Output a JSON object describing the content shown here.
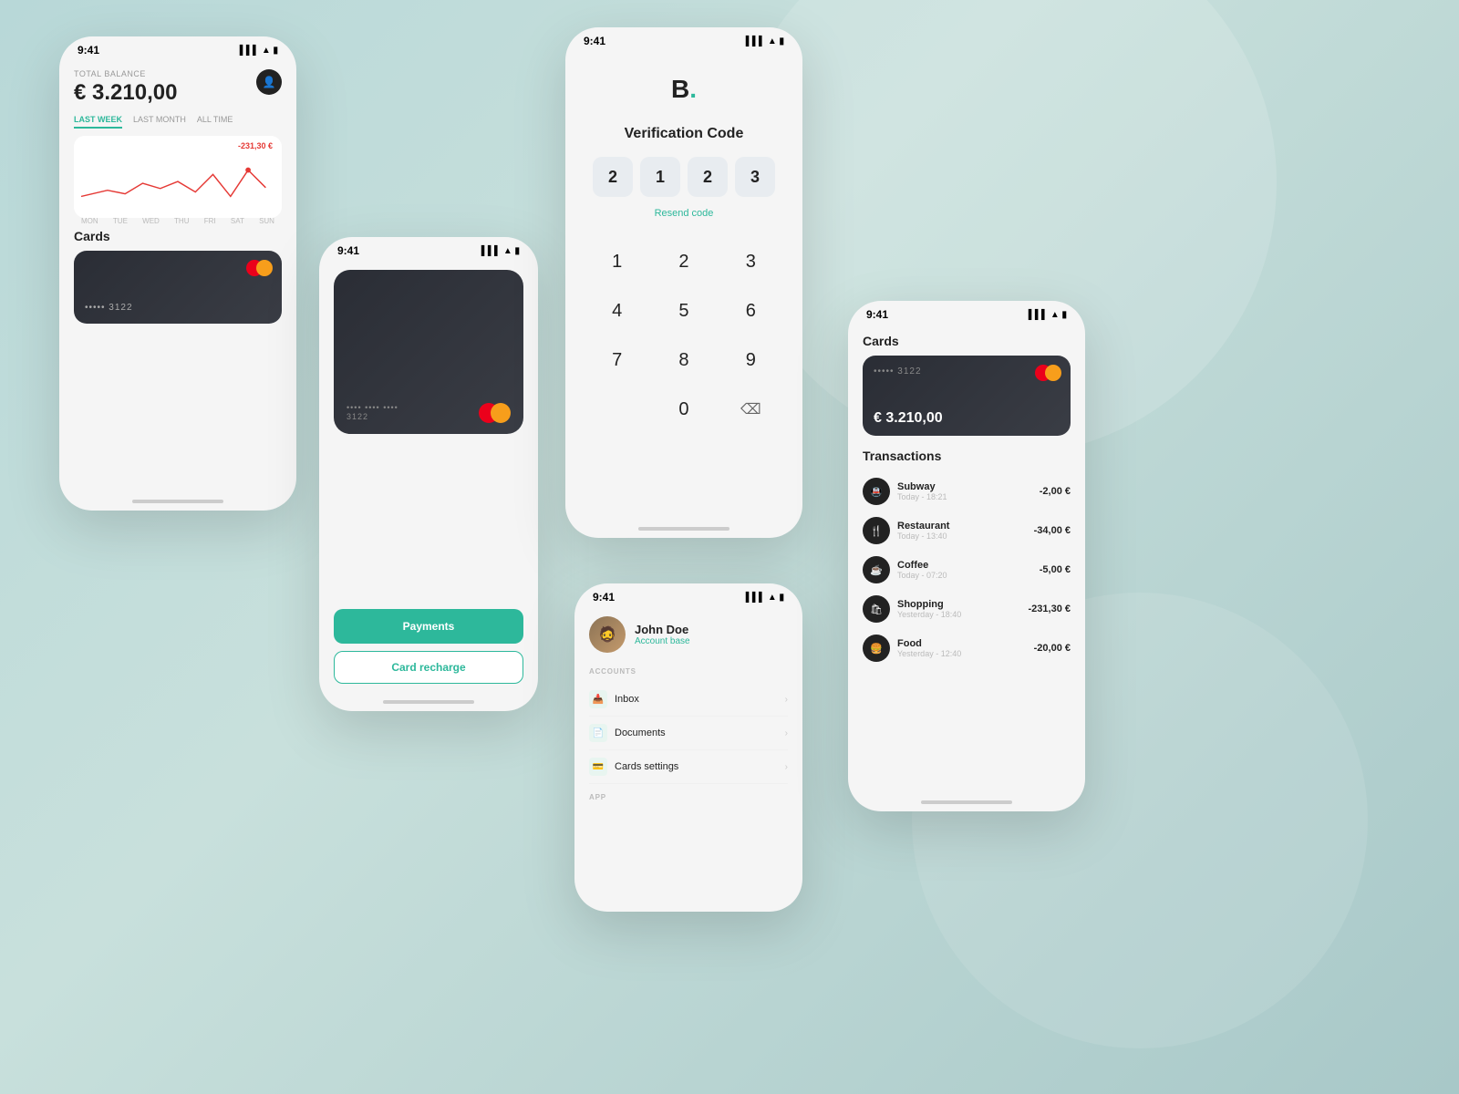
{
  "background": "#b8d8d8",
  "phone1": {
    "status_time": "9:41",
    "balance_label": "TOTAL BALANCE",
    "balance": "€ 3.210,00",
    "time_tabs": [
      "LAST WEEK",
      "LAST MONTH",
      "ALL TIME"
    ],
    "active_tab": 0,
    "chart_negative": "-231,30 €",
    "chart_days": [
      "MON",
      "TUE",
      "WED",
      "THU",
      "FRI",
      "SAT",
      "SUN"
    ],
    "cards_title": "Cards",
    "card_number": "••••• 3122"
  },
  "phone2": {
    "status_time": "9:41",
    "card_number": "••••• 3122",
    "btn_payments": "Payments",
    "btn_recharge": "Card recharge"
  },
  "phone3": {
    "status_time": "9:41",
    "logo": "B.",
    "verify_title": "Verification Code",
    "code_digits": [
      "2",
      "1",
      "2",
      "3"
    ],
    "resend_code": "Resend code",
    "numpad": [
      "1",
      "2",
      "3",
      "4",
      "5",
      "6",
      "7",
      "8",
      "9",
      "0",
      "⌫"
    ]
  },
  "phone4": {
    "status_time": "9:41",
    "profile_name": "John Doe",
    "profile_sub": "Account base",
    "section_accounts": "ACCOUNTS",
    "menu_items": [
      {
        "icon": "📥",
        "label": "Inbox"
      },
      {
        "icon": "📄",
        "label": "Documents"
      },
      {
        "icon": "💳",
        "label": "Cards settings"
      }
    ],
    "section_app": "APP"
  },
  "phone5": {
    "status_time": "9:41",
    "cards_title": "Cards",
    "card_number": "••••• 3122",
    "card_balance": "€ 3.210,00",
    "tx_title": "Transactions",
    "transactions": [
      {
        "icon": "🚇",
        "name": "Subway",
        "time": "Today - 18:21",
        "amount": "-2,00 €"
      },
      {
        "icon": "🍴",
        "name": "Restaurant",
        "time": "Today - 13:40",
        "amount": "-34,00 €"
      },
      {
        "icon": "☕",
        "name": "Coffee",
        "time": "Today - 07:20",
        "amount": "-5,00 €"
      },
      {
        "icon": "🛍",
        "name": "Shopping",
        "time": "Yesterday - 18:40",
        "amount": "-231,30 €"
      },
      {
        "icon": "🍔",
        "name": "Food",
        "time": "Yesterday - 12:40",
        "amount": "-20,00 €"
      }
    ]
  }
}
